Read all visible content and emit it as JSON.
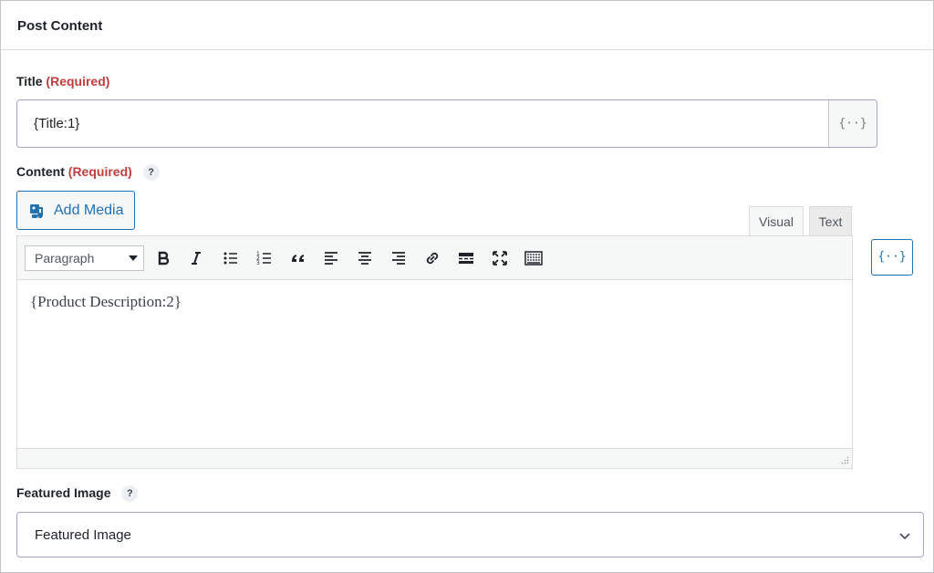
{
  "panel": {
    "title": "Post Content"
  },
  "title_field": {
    "label": "Title",
    "required": "(Required)",
    "value": "{Title:1}",
    "merge_tag": "{··}"
  },
  "content_field": {
    "label": "Content",
    "required": "(Required)",
    "help": "?",
    "add_media": "Add Media",
    "tabs": {
      "visual": "Visual",
      "text": "Text"
    },
    "format": "Paragraph",
    "body": "{Product Description:2}",
    "merge_tag": "{··}",
    "toolbar_icons": [
      "bold-icon",
      "italic-icon",
      "bulleted-list-icon",
      "numbered-list-icon",
      "blockquote-icon",
      "align-left-icon",
      "align-center-icon",
      "align-right-icon",
      "link-icon",
      "read-more-icon",
      "fullscreen-icon",
      "toolbar-toggle-icon"
    ]
  },
  "featured_image": {
    "label": "Featured Image",
    "help": "?",
    "value": "Featured Image"
  },
  "colors": {
    "accent": "#2271b1",
    "required": "#c33d3d",
    "input_border": "#a7a2cf"
  }
}
